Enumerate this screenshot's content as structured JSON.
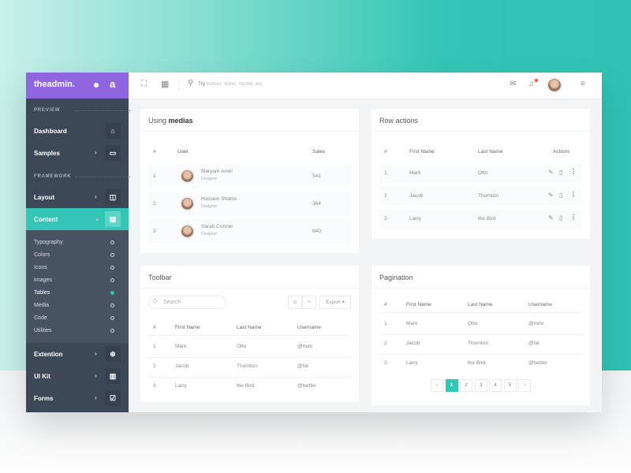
{
  "colors": {
    "brand": "#9066e0",
    "accent": "#33c5b5",
    "sidebar": "#3c4757"
  },
  "sidebar": {
    "logo": "theadmin.",
    "logo_short": "a",
    "sections": [
      "PREVIEW",
      "FRAMEWORK"
    ],
    "items": [
      {
        "label": "Dashboard",
        "icon": "home-icon",
        "glyph": "⌂"
      },
      {
        "label": "Samples",
        "icon": "monitor-icon",
        "glyph": "▭"
      },
      {
        "label": "Layout",
        "icon": "layout-icon",
        "glyph": "◫"
      },
      {
        "label": "Content",
        "icon": "content-icon",
        "glyph": "▤"
      },
      {
        "label": "Extention",
        "icon": "plus-circle-icon",
        "glyph": "⊕"
      },
      {
        "label": "UI Kit",
        "icon": "ui-kit-icon",
        "glyph": "▥"
      },
      {
        "label": "Forms",
        "icon": "checkbox-icon",
        "glyph": "☑"
      }
    ],
    "submenu": [
      "Typography",
      "Colors",
      "Icons",
      "Images",
      "Tables",
      "Media",
      "Code",
      "Utilities"
    ],
    "active_submenu": "Tables"
  },
  "topbar": {
    "search_prefix": "Try",
    "search_placeholder": "button, slider, modal, etc."
  },
  "medias": {
    "title_a": "Using ",
    "title_b": "medias",
    "headers": [
      "#",
      "User",
      "Sales"
    ],
    "rows": [
      {
        "n": "1",
        "name": "Maryam Amiri",
        "role": "Designer",
        "sales": "541"
      },
      {
        "n": "2",
        "name": "Hossein Shams",
        "role": "Designer",
        "sales": "364"
      },
      {
        "n": "3",
        "name": "Sarah Conner",
        "role": "Designer",
        "sales": "840"
      }
    ]
  },
  "rowactions": {
    "title": "Row actions",
    "headers": [
      "#",
      "First Name",
      "Last Name",
      "Actions"
    ],
    "rows": [
      [
        "1",
        "Mark",
        "Otto"
      ],
      [
        "2",
        "Jacob",
        "Thornton"
      ],
      [
        "3",
        "Larry",
        "the Bird"
      ]
    ]
  },
  "toolbar": {
    "title": "Toolbar",
    "search_placeholder": "Search",
    "export_label": "Export ▾",
    "headers": [
      "#",
      "First Name",
      "Last Name",
      "Username"
    ],
    "rows": [
      [
        "1",
        "Mark",
        "Otto",
        "@mdo"
      ],
      [
        "2",
        "Jacob",
        "Thornton",
        "@fat"
      ],
      [
        "3",
        "Larry",
        "the Bird",
        "@twitter"
      ]
    ]
  },
  "pagination": {
    "title": "Pagination",
    "headers": [
      "#",
      "First Name",
      "Last Name",
      "Username"
    ],
    "rows": [
      [
        "1",
        "Mark",
        "Otto",
        "@mdo"
      ],
      [
        "2",
        "Jacob",
        "Thornton",
        "@fat"
      ],
      [
        "3",
        "Larry",
        "the Bird",
        "@twitter"
      ]
    ],
    "pages": [
      "‹",
      "1",
      "2",
      "3",
      "4",
      "5",
      "›"
    ],
    "current": "1"
  }
}
